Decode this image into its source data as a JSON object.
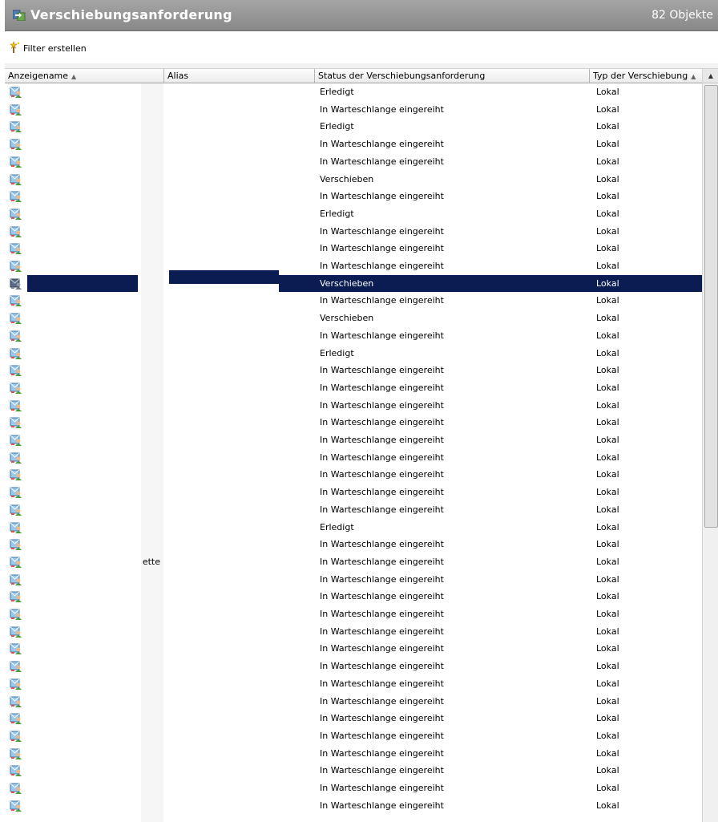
{
  "window": {
    "title": "Verschiebungsanforderung",
    "count": "82 Objekte"
  },
  "toolbar": {
    "filter_label": "Filter erstellen"
  },
  "columns": [
    {
      "label": "Anzeigename",
      "sort": "asc"
    },
    {
      "label": "Alias"
    },
    {
      "label": "Status der Verschiebungsanforderung"
    },
    {
      "label": "Typ der Verschiebung",
      "sort": "asc"
    }
  ],
  "selected_row_index": 11,
  "rows": [
    {
      "name": "",
      "alias": "",
      "status": "Erledigt",
      "type": "Lokal"
    },
    {
      "name": "",
      "alias": "",
      "status": "In Warteschlange eingereiht",
      "type": "Lokal"
    },
    {
      "name": "",
      "alias": "",
      "status": "Erledigt",
      "type": "Lokal"
    },
    {
      "name": "",
      "alias": "",
      "status": "In Warteschlange eingereiht",
      "type": "Lokal"
    },
    {
      "name": "",
      "alias": "",
      "status": "In Warteschlange eingereiht",
      "type": "Lokal"
    },
    {
      "name": "",
      "alias": "",
      "status": "Verschieben",
      "type": "Lokal"
    },
    {
      "name": "",
      "alias": "",
      "status": "In Warteschlange eingereiht",
      "type": "Lokal"
    },
    {
      "name": "",
      "alias": "",
      "status": "Erledigt",
      "type": "Lokal"
    },
    {
      "name": "",
      "alias": "",
      "status": "In Warteschlange eingereiht",
      "type": "Lokal"
    },
    {
      "name": "",
      "alias": "",
      "status": "In Warteschlange eingereiht",
      "type": "Lokal"
    },
    {
      "name": "",
      "alias": "",
      "status": "In Warteschlange eingereiht",
      "type": "Lokal"
    },
    {
      "name": "",
      "alias": "",
      "status": "Verschieben",
      "type": "Lokal"
    },
    {
      "name": "",
      "alias": "",
      "status": "In Warteschlange eingereiht",
      "type": "Lokal"
    },
    {
      "name": "",
      "alias": "",
      "status": "Verschieben",
      "type": "Lokal"
    },
    {
      "name": "",
      "alias": "",
      "status": "In Warteschlange eingereiht",
      "type": "Lokal"
    },
    {
      "name": "",
      "alias": "",
      "status": "Erledigt",
      "type": "Lokal"
    },
    {
      "name": "",
      "alias": "",
      "status": "In Warteschlange eingereiht",
      "type": "Lokal"
    },
    {
      "name": "",
      "alias": "",
      "status": "In Warteschlange eingereiht",
      "type": "Lokal"
    },
    {
      "name": "",
      "alias": "",
      "status": "In Warteschlange eingereiht",
      "type": "Lokal"
    },
    {
      "name": "",
      "alias": "",
      "status": "In Warteschlange eingereiht",
      "type": "Lokal"
    },
    {
      "name": "",
      "alias": "",
      "status": "In Warteschlange eingereiht",
      "type": "Lokal"
    },
    {
      "name": "",
      "alias": "",
      "status": "In Warteschlange eingereiht",
      "type": "Lokal"
    },
    {
      "name": "",
      "alias": "",
      "status": "In Warteschlange eingereiht",
      "type": "Lokal"
    },
    {
      "name": "",
      "alias": "",
      "status": "In Warteschlange eingereiht",
      "type": "Lokal"
    },
    {
      "name": "",
      "alias": "",
      "status": "In Warteschlange eingereiht",
      "type": "Lokal"
    },
    {
      "name": "",
      "alias": "",
      "status": "Erledigt",
      "type": "Lokal"
    },
    {
      "name": "",
      "alias": "",
      "status": "In Warteschlange eingereiht",
      "type": "Lokal"
    },
    {
      "name": "ette",
      "alias": "",
      "status": "In Warteschlange eingereiht",
      "type": "Lokal"
    },
    {
      "name": "",
      "alias": "",
      "status": "In Warteschlange eingereiht",
      "type": "Lokal"
    },
    {
      "name": "",
      "alias": "",
      "status": "In Warteschlange eingereiht",
      "type": "Lokal"
    },
    {
      "name": "",
      "alias": "",
      "status": "In Warteschlange eingereiht",
      "type": "Lokal"
    },
    {
      "name": "",
      "alias": "",
      "status": "In Warteschlange eingereiht",
      "type": "Lokal"
    },
    {
      "name": "",
      "alias": "",
      "status": "In Warteschlange eingereiht",
      "type": "Lokal"
    },
    {
      "name": "",
      "alias": "",
      "status": "In Warteschlange eingereiht",
      "type": "Lokal"
    },
    {
      "name": "",
      "alias": "",
      "status": "In Warteschlange eingereiht",
      "type": "Lokal"
    },
    {
      "name": "",
      "alias": "",
      "status": "In Warteschlange eingereiht",
      "type": "Lokal"
    },
    {
      "name": "",
      "alias": "",
      "status": "In Warteschlange eingereiht",
      "type": "Lokal"
    },
    {
      "name": "",
      "alias": "",
      "status": "In Warteschlange eingereiht",
      "type": "Lokal"
    },
    {
      "name": "",
      "alias": "",
      "status": "In Warteschlange eingereiht",
      "type": "Lokal"
    },
    {
      "name": "",
      "alias": "",
      "status": "In Warteschlange eingereiht",
      "type": "Lokal"
    },
    {
      "name": "",
      "alias": "",
      "status": "In Warteschlange eingereiht",
      "type": "Lokal"
    },
    {
      "name": "",
      "alias": "",
      "status": "In Warteschlange eingereiht",
      "type": "Lokal"
    }
  ],
  "icons": {
    "title": "move-request-icon",
    "filter": "filter-wand-icon",
    "row": "mailbox-user-icon",
    "row_selected": "mailbox-user-selected-icon"
  },
  "colors": {
    "selection": "#0a1c52",
    "titlebar": "#9a9a9a"
  }
}
